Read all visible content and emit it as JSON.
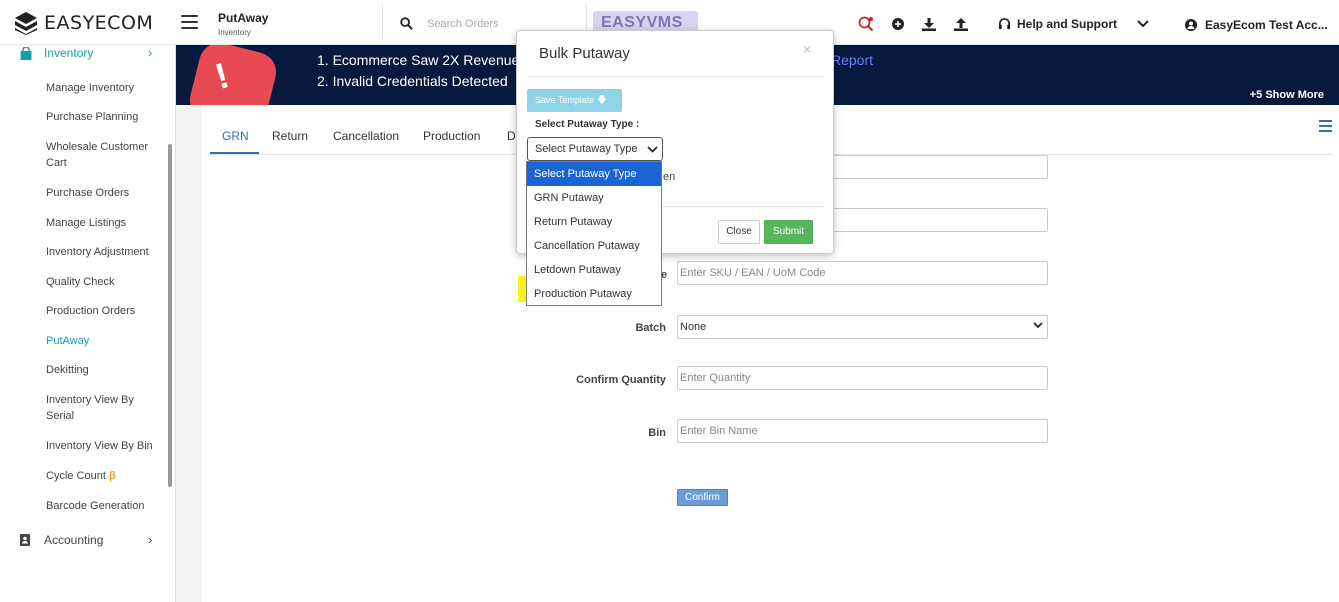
{
  "header": {
    "logo_text": "EASYECOM",
    "page_title": "PutAway",
    "page_subtitle": "Inventory",
    "search_placeholder": "Search Orders",
    "vms_badge": "EASYVMS",
    "help_label": "Help and Support",
    "account_label": "EasyEcom Test Acc..."
  },
  "sidebar": {
    "section": "Inventory",
    "items": [
      {
        "label": "Manage Inventory"
      },
      {
        "label": "Purchase Planning"
      },
      {
        "label": "Wholesale Customer Cart"
      },
      {
        "label": "Purchase Orders"
      },
      {
        "label": "Manage Listings"
      },
      {
        "label": "Inventory Adjustment"
      },
      {
        "label": "Quality Check"
      },
      {
        "label": "Production Orders"
      },
      {
        "label": "PutAway"
      },
      {
        "label": "Dekitting"
      },
      {
        "label": "Inventory View By Serial"
      },
      {
        "label": "Inventory View By Bin"
      },
      {
        "label": "Cycle Count",
        "badge": "β"
      },
      {
        "label": "Barcode Generation"
      }
    ],
    "accounting": "Accounting"
  },
  "banner": {
    "line1": "1. Ecommerce Saw 2X Revenue",
    "line2": "2. Invalid Credentials Detected",
    "report_fragment": "Report",
    "show_more": "+5 Show More"
  },
  "tabs": [
    {
      "label": "GRN"
    },
    {
      "label": "Return"
    },
    {
      "label": "Cancellation"
    },
    {
      "label": "Production"
    },
    {
      "label": "D"
    }
  ],
  "form": {
    "sku_placeholder": "Enter SKU / EAN / UoM Code",
    "sku_label_fragment": "e",
    "batch_label": "Batch",
    "batch_value": "None",
    "confirm_qty_label": "Confirm Quantity",
    "qty_placeholder": "Enter Quantity",
    "bin_label": "Bin",
    "bin_placeholder": "Enter Bin Name",
    "confirm_button": "Confirm"
  },
  "modal": {
    "title": "Bulk Putaway",
    "close_glyph": "×",
    "save_template": "Save Template",
    "putaway_type_label": "Select Putaway Type :",
    "select_value": "Select Putaway Type",
    "hidden_text_fragment": "en",
    "close_button": "Close",
    "submit_button": "Submit"
  },
  "dropdown": {
    "options": [
      "Select Putaway Type",
      "GRN Putaway",
      "Return Putaway",
      "Cancellation Putaway",
      "Letdown Putaway",
      "Production Putaway"
    ]
  },
  "colors": {
    "accent_teal": "#1a9bb0",
    "banner_bg": "#071a3e",
    "submit_green": "#58b55b",
    "option_selected": "#1a64d6",
    "highlight_yellow": "#fbf11a"
  }
}
